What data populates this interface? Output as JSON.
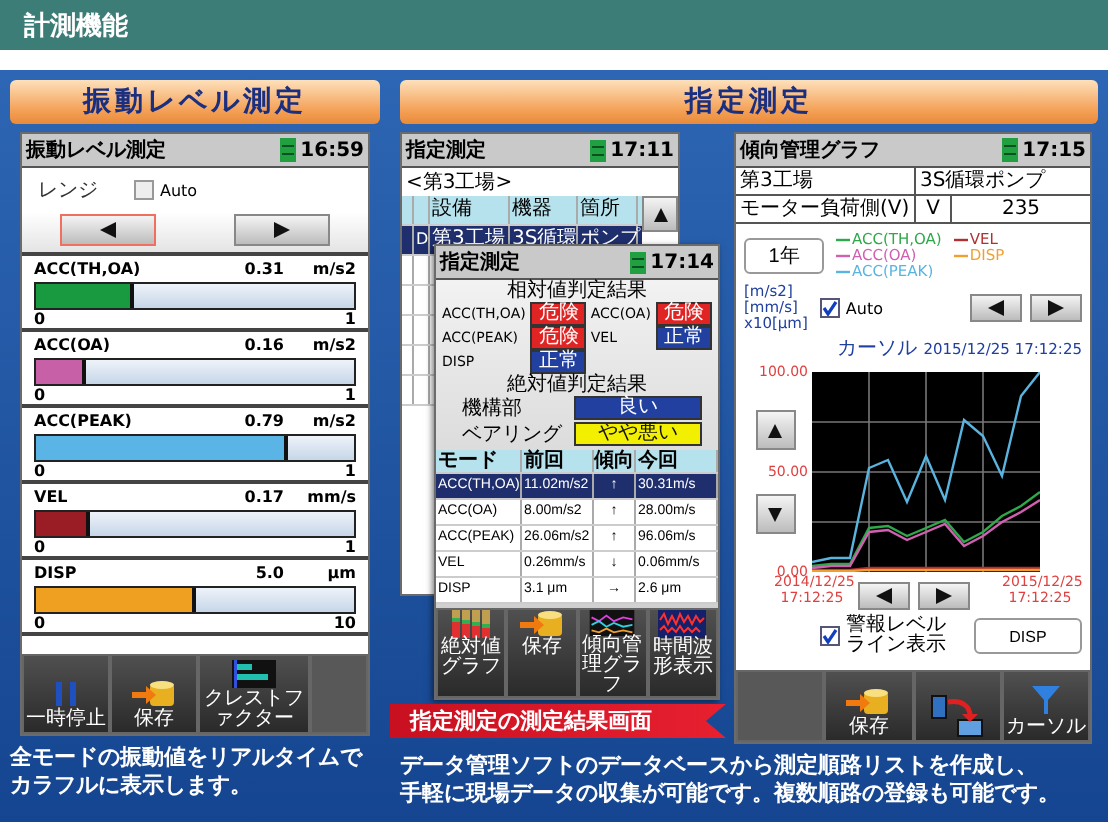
{
  "header": {
    "title": "計測機能"
  },
  "sections": [
    {
      "title": "振動レベル測定"
    },
    {
      "title": "指定測定"
    }
  ],
  "level_screen": {
    "title": "振動レベル測定",
    "time": "16:59",
    "range_label": "レンジ",
    "auto": {
      "label": "Auto",
      "checked": false
    },
    "range_buttons": [
      {
        "kind": "left",
        "selected": true
      },
      {
        "kind": "right",
        "selected": false
      }
    ],
    "meters": [
      {
        "name": "ACC(TH,OA)",
        "value": "0.31",
        "unit": "m/s2",
        "level": 0.31,
        "color": "#1a9a40",
        "min": "0",
        "max": "1"
      },
      {
        "name": "ACC(OA)",
        "value": "0.16",
        "unit": "m/s2",
        "level": 0.16,
        "color": "#c860a8",
        "min": "0",
        "max": "1"
      },
      {
        "name": "ACC(PEAK)",
        "value": "0.79",
        "unit": "m/s2",
        "level": 0.79,
        "color": "#5ab4e6",
        "min": "0",
        "max": "1"
      },
      {
        "name": "VEL",
        "value": "0.17",
        "unit": "mm/s",
        "level": 0.17,
        "color": "#9a1c24",
        "min": "0",
        "max": "1"
      },
      {
        "name": "DISP",
        "value": "5.0",
        "unit": "μm",
        "level": 0.5,
        "color": "#f0a020",
        "min": "0",
        "max": "10"
      }
    ],
    "toolbar": [
      {
        "kind": "pause",
        "label": "一時停止"
      },
      {
        "kind": "save",
        "label": "保存"
      },
      {
        "kind": "crest",
        "label": "クレストファクター"
      },
      {
        "kind": "empty"
      }
    ]
  },
  "left_caption": [
    "全モードの振動値をリアルタイムで",
    "カラフルに表示します。"
  ],
  "route_screen": {
    "title": "指定測定",
    "time": "17:11",
    "location": "<第3工場>",
    "columns": [
      "設備",
      "機器",
      "箇所"
    ],
    "rows": [
      {
        "mark": "D",
        "cells": [
          "第3工場",
          "3S循環",
          "ポンプ"
        ],
        "selected": true
      }
    ]
  },
  "result_dialog": {
    "title": "指定測定",
    "time": "17:14",
    "relative": {
      "heading": "相対値判定結果",
      "items": [
        {
          "name": "ACC(TH,OA)",
          "result": "危険",
          "kind": "danger"
        },
        {
          "name": "ACC(OA)",
          "result": "危険",
          "kind": "danger"
        },
        {
          "name": "ACC(PEAK)",
          "result": "危険",
          "kind": "danger"
        },
        {
          "name": "VEL",
          "result": "正常",
          "kind": "normal"
        },
        {
          "name": "DISP",
          "result": "正常",
          "kind": "normal"
        }
      ]
    },
    "absolute": {
      "heading": "絶対値判定結果",
      "items": [
        {
          "name": "機構部",
          "result": "良い",
          "kind": "good"
        },
        {
          "name": "ベアリング",
          "result": "やや悪い",
          "kind": "fair"
        }
      ]
    },
    "table": {
      "columns": [
        "モード",
        "前回",
        "傾向",
        "今回"
      ],
      "rows": [
        {
          "cells": [
            "ACC(TH,OA)",
            "11.02m/s2",
            "↑",
            "30.31m/s"
          ],
          "selected": true
        },
        {
          "cells": [
            "ACC(OA)",
            "8.00m/s2",
            "↑",
            "28.00m/s"
          ],
          "selected": false
        },
        {
          "cells": [
            "ACC(PEAK)",
            "26.06m/s2",
            "↑",
            "96.06m/s"
          ],
          "selected": false
        },
        {
          "cells": [
            "VEL",
            "0.26mm/s",
            "↓",
            "0.06mm/s"
          ],
          "selected": false
        },
        {
          "cells": [
            "DISP",
            "3.1 μm",
            "→",
            "2.6 μm"
          ],
          "selected": false
        }
      ]
    },
    "toolbar": [
      {
        "kind": "bars",
        "label": "絶対値グラフ"
      },
      {
        "kind": "save",
        "label": "保存"
      },
      {
        "kind": "trend",
        "label": "傾向管理グラフ"
      },
      {
        "kind": "wave",
        "label": "時間波形表示"
      }
    ]
  },
  "banner": "指定測定の測定結果画面",
  "trend_screen": {
    "title": "傾向管理グラフ",
    "time": "17:15",
    "info": [
      [
        "第3工場",
        "3S循環ポンプ"
      ],
      [
        "モーター負荷側(V)",
        "V",
        "235"
      ]
    ],
    "period": "1年",
    "units": [
      "[m/s2]",
      "[mm/s]",
      "x10[μm]"
    ],
    "auto": {
      "label": "Auto",
      "checked": true
    },
    "cursor_label": "カーソル",
    "cursor_time": "2015/12/25 17:12:25",
    "chart_data": {
      "type": "line",
      "categories": [
        "2014/12/25 17:12:25",
        null,
        null,
        null,
        null,
        null,
        null,
        null,
        null,
        null,
        null,
        null,
        "2015/12/25 17:12:25"
      ],
      "ylim": [
        0,
        100
      ],
      "grid": true,
      "yticks": [
        {
          "value": 0,
          "label": "0.00"
        },
        {
          "value": 50,
          "label": "50.00"
        },
        {
          "value": 100,
          "label": "100.00"
        }
      ],
      "series": [
        {
          "name": "ACC(TH,OA)",
          "color": "#2ea84a",
          "values": [
            3,
            4,
            4,
            22,
            23,
            18,
            22,
            26,
            15,
            20,
            28,
            33,
            40
          ]
        },
        {
          "name": "VEL",
          "color": "#b03030",
          "values": [
            1,
            1,
            1,
            2,
            2,
            2,
            2,
            2,
            2,
            2,
            2,
            2,
            2
          ]
        },
        {
          "name": "ACC(OA)",
          "color": "#d060b0",
          "values": [
            2,
            3,
            3,
            20,
            21,
            16,
            20,
            24,
            13,
            18,
            25,
            30,
            36
          ]
        },
        {
          "name": "DISP",
          "color": "#f0a030",
          "values": [
            0,
            0,
            0,
            1,
            1,
            1,
            1,
            1,
            1,
            1,
            1,
            1,
            1
          ]
        },
        {
          "name": "ACC(PEAK)",
          "color": "#5ab4e0",
          "values": [
            5,
            7,
            7,
            52,
            56,
            35,
            58,
            36,
            76,
            68,
            48,
            88,
            100
          ]
        }
      ]
    },
    "alarm_line": {
      "label": "警報レベルライン表示",
      "checked": true
    },
    "mode_button": "DISP",
    "toolbar": [
      {
        "kind": "empty"
      },
      {
        "kind": "save",
        "label": "保存"
      },
      {
        "kind": "swap"
      },
      {
        "kind": "cursor",
        "label": "カーソル"
      }
    ]
  },
  "right_caption": [
    "データ管理ソフトのデータベースから測定順路リストを作成し、",
    "手軽に現場データの収集が可能です。複数順路の登録も可能です。"
  ]
}
